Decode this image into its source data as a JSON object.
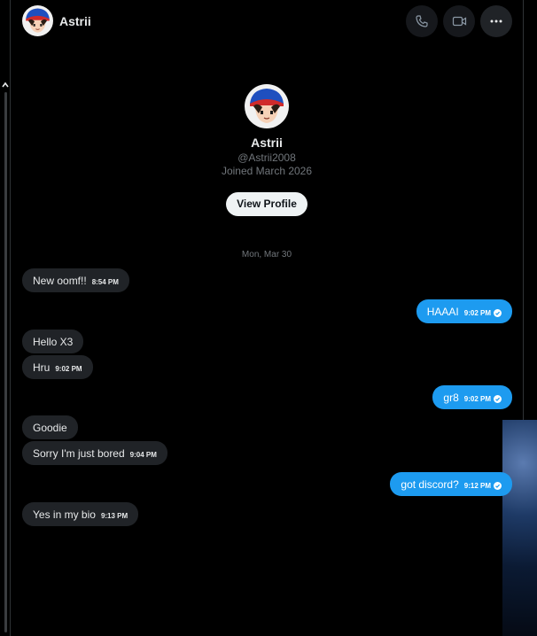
{
  "header": {
    "name": "Astrii"
  },
  "profile": {
    "name": "Astrii",
    "handle": "@Astrii2008",
    "joined": "Joined March 2026",
    "view_profile_label": "View Profile"
  },
  "conversation": {
    "date_label": "Mon, Mar 30",
    "messages": [
      {
        "direction": "in",
        "text": "New oomf!!",
        "time": "8:54 PM"
      },
      {
        "direction": "out",
        "text": "HAAAI",
        "time": "9:02 PM",
        "status": "read"
      },
      {
        "direction": "in",
        "text": "Hello X3",
        "time": ""
      },
      {
        "direction": "in",
        "text": "Hru",
        "time": "9:02 PM"
      },
      {
        "direction": "out",
        "text": "gr8",
        "time": "9:02 PM",
        "status": "read"
      },
      {
        "direction": "in",
        "text": "Goodie",
        "time": ""
      },
      {
        "direction": "in",
        "text": "Sorry I'm just bored",
        "time": "9:04 PM"
      },
      {
        "direction": "out",
        "text": "got discord?",
        "time": "9:12 PM",
        "status": "read"
      },
      {
        "direction": "in",
        "text": "Yes in my bio",
        "time": "9:13 PM"
      }
    ]
  },
  "icons": {
    "call": "phone-icon",
    "video": "video-camera-icon",
    "more": "more-horizontal-icon",
    "read": "check-circle-icon"
  },
  "colors": {
    "background": "#000000",
    "incoming_bubble": "#202327",
    "outgoing_bubble": "#1d9bf0",
    "muted_text": "#71767b",
    "primary_text": "#e7e9ea"
  }
}
